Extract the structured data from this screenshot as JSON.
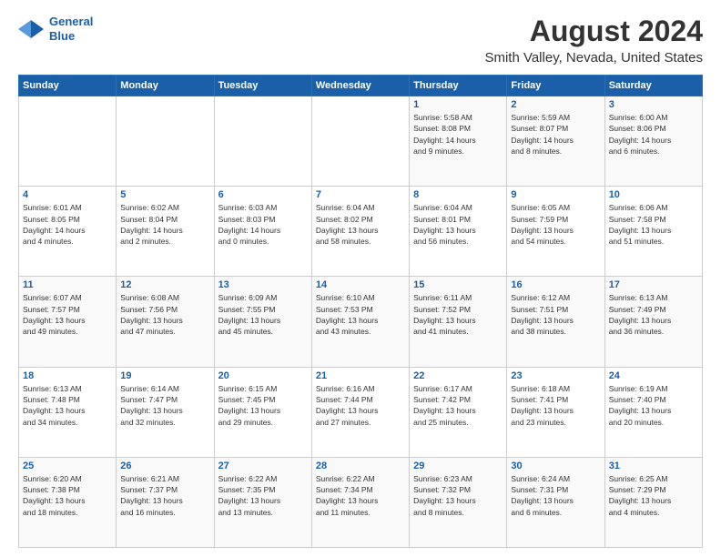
{
  "header": {
    "logo": {
      "line1": "General",
      "line2": "Blue"
    },
    "title": "August 2024",
    "subtitle": "Smith Valley, Nevada, United States"
  },
  "calendar": {
    "weekdays": [
      "Sunday",
      "Monday",
      "Tuesday",
      "Wednesday",
      "Thursday",
      "Friday",
      "Saturday"
    ],
    "weeks": [
      [
        {
          "day": "",
          "info": ""
        },
        {
          "day": "",
          "info": ""
        },
        {
          "day": "",
          "info": ""
        },
        {
          "day": "",
          "info": ""
        },
        {
          "day": "1",
          "info": "Sunrise: 5:58 AM\nSunset: 8:08 PM\nDaylight: 14 hours\nand 9 minutes."
        },
        {
          "day": "2",
          "info": "Sunrise: 5:59 AM\nSunset: 8:07 PM\nDaylight: 14 hours\nand 8 minutes."
        },
        {
          "day": "3",
          "info": "Sunrise: 6:00 AM\nSunset: 8:06 PM\nDaylight: 14 hours\nand 6 minutes."
        }
      ],
      [
        {
          "day": "4",
          "info": "Sunrise: 6:01 AM\nSunset: 8:05 PM\nDaylight: 14 hours\nand 4 minutes."
        },
        {
          "day": "5",
          "info": "Sunrise: 6:02 AM\nSunset: 8:04 PM\nDaylight: 14 hours\nand 2 minutes."
        },
        {
          "day": "6",
          "info": "Sunrise: 6:03 AM\nSunset: 8:03 PM\nDaylight: 14 hours\nand 0 minutes."
        },
        {
          "day": "7",
          "info": "Sunrise: 6:04 AM\nSunset: 8:02 PM\nDaylight: 13 hours\nand 58 minutes."
        },
        {
          "day": "8",
          "info": "Sunrise: 6:04 AM\nSunset: 8:01 PM\nDaylight: 13 hours\nand 56 minutes."
        },
        {
          "day": "9",
          "info": "Sunrise: 6:05 AM\nSunset: 7:59 PM\nDaylight: 13 hours\nand 54 minutes."
        },
        {
          "day": "10",
          "info": "Sunrise: 6:06 AM\nSunset: 7:58 PM\nDaylight: 13 hours\nand 51 minutes."
        }
      ],
      [
        {
          "day": "11",
          "info": "Sunrise: 6:07 AM\nSunset: 7:57 PM\nDaylight: 13 hours\nand 49 minutes."
        },
        {
          "day": "12",
          "info": "Sunrise: 6:08 AM\nSunset: 7:56 PM\nDaylight: 13 hours\nand 47 minutes."
        },
        {
          "day": "13",
          "info": "Sunrise: 6:09 AM\nSunset: 7:55 PM\nDaylight: 13 hours\nand 45 minutes."
        },
        {
          "day": "14",
          "info": "Sunrise: 6:10 AM\nSunset: 7:53 PM\nDaylight: 13 hours\nand 43 minutes."
        },
        {
          "day": "15",
          "info": "Sunrise: 6:11 AM\nSunset: 7:52 PM\nDaylight: 13 hours\nand 41 minutes."
        },
        {
          "day": "16",
          "info": "Sunrise: 6:12 AM\nSunset: 7:51 PM\nDaylight: 13 hours\nand 38 minutes."
        },
        {
          "day": "17",
          "info": "Sunrise: 6:13 AM\nSunset: 7:49 PM\nDaylight: 13 hours\nand 36 minutes."
        }
      ],
      [
        {
          "day": "18",
          "info": "Sunrise: 6:13 AM\nSunset: 7:48 PM\nDaylight: 13 hours\nand 34 minutes."
        },
        {
          "day": "19",
          "info": "Sunrise: 6:14 AM\nSunset: 7:47 PM\nDaylight: 13 hours\nand 32 minutes."
        },
        {
          "day": "20",
          "info": "Sunrise: 6:15 AM\nSunset: 7:45 PM\nDaylight: 13 hours\nand 29 minutes."
        },
        {
          "day": "21",
          "info": "Sunrise: 6:16 AM\nSunset: 7:44 PM\nDaylight: 13 hours\nand 27 minutes."
        },
        {
          "day": "22",
          "info": "Sunrise: 6:17 AM\nSunset: 7:42 PM\nDaylight: 13 hours\nand 25 minutes."
        },
        {
          "day": "23",
          "info": "Sunrise: 6:18 AM\nSunset: 7:41 PM\nDaylight: 13 hours\nand 23 minutes."
        },
        {
          "day": "24",
          "info": "Sunrise: 6:19 AM\nSunset: 7:40 PM\nDaylight: 13 hours\nand 20 minutes."
        }
      ],
      [
        {
          "day": "25",
          "info": "Sunrise: 6:20 AM\nSunset: 7:38 PM\nDaylight: 13 hours\nand 18 minutes."
        },
        {
          "day": "26",
          "info": "Sunrise: 6:21 AM\nSunset: 7:37 PM\nDaylight: 13 hours\nand 16 minutes."
        },
        {
          "day": "27",
          "info": "Sunrise: 6:22 AM\nSunset: 7:35 PM\nDaylight: 13 hours\nand 13 minutes."
        },
        {
          "day": "28",
          "info": "Sunrise: 6:22 AM\nSunset: 7:34 PM\nDaylight: 13 hours\nand 11 minutes."
        },
        {
          "day": "29",
          "info": "Sunrise: 6:23 AM\nSunset: 7:32 PM\nDaylight: 13 hours\nand 8 minutes."
        },
        {
          "day": "30",
          "info": "Sunrise: 6:24 AM\nSunset: 7:31 PM\nDaylight: 13 hours\nand 6 minutes."
        },
        {
          "day": "31",
          "info": "Sunrise: 6:25 AM\nSunset: 7:29 PM\nDaylight: 13 hours\nand 4 minutes."
        }
      ]
    ]
  }
}
